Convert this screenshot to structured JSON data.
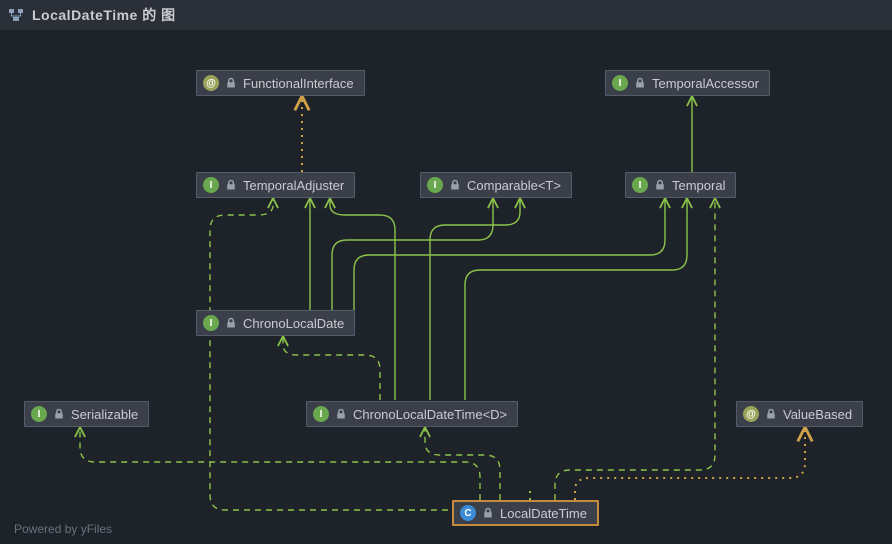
{
  "title": "LocalDateTime 的 图",
  "footer": "Powered by yFiles",
  "nodes": {
    "functionalInterface": {
      "label": "FunctionalInterface",
      "kind": "annotation"
    },
    "temporalAccessor": {
      "label": "TemporalAccessor",
      "kind": "interface"
    },
    "temporalAdjuster": {
      "label": "TemporalAdjuster",
      "kind": "interface"
    },
    "comparable": {
      "label": "Comparable<T>",
      "kind": "interface"
    },
    "temporal": {
      "label": "Temporal",
      "kind": "interface"
    },
    "chronoLocalDate": {
      "label": "ChronoLocalDate",
      "kind": "interface"
    },
    "serializable": {
      "label": "Serializable",
      "kind": "interface"
    },
    "chronoLocalDateTime": {
      "label": "ChronoLocalDateTime<D>",
      "kind": "interface"
    },
    "valueBased": {
      "label": "ValueBased",
      "kind": "annotation"
    },
    "localDateTime": {
      "label": "LocalDateTime",
      "kind": "class",
      "selected": true
    }
  },
  "edges": [
    {
      "from": "temporalAdjuster",
      "to": "functionalInterface",
      "style": "dotA",
      "rel": "annotated-by"
    },
    {
      "from": "temporal",
      "to": "temporalAccessor",
      "style": "solid",
      "rel": "extends"
    },
    {
      "from": "chronoLocalDate",
      "to": "temporalAdjuster",
      "style": "solid",
      "rel": "extends"
    },
    {
      "from": "chronoLocalDate",
      "to": "comparable",
      "style": "solid",
      "rel": "extends"
    },
    {
      "from": "chronoLocalDate",
      "to": "temporal",
      "style": "solid",
      "rel": "extends"
    },
    {
      "from": "chronoLocalDateTime",
      "to": "temporalAdjuster",
      "style": "solid",
      "rel": "extends"
    },
    {
      "from": "chronoLocalDateTime",
      "to": "comparable",
      "style": "solid",
      "rel": "extends"
    },
    {
      "from": "chronoLocalDateTime",
      "to": "temporal",
      "style": "solid",
      "rel": "extends"
    },
    {
      "from": "chronoLocalDateTime",
      "to": "chronoLocalDate",
      "style": "dash",
      "rel": "uses"
    },
    {
      "from": "localDateTime",
      "to": "chronoLocalDateTime",
      "style": "dash",
      "rel": "implements"
    },
    {
      "from": "localDateTime",
      "to": "serializable",
      "style": "dash",
      "rel": "implements"
    },
    {
      "from": "localDateTime",
      "to": "temporalAdjuster",
      "style": "dash",
      "rel": "implements"
    },
    {
      "from": "localDateTime",
      "to": "temporal",
      "style": "dash",
      "rel": "implements"
    },
    {
      "from": "localDateTime",
      "to": "valueBased",
      "style": "dotA",
      "rel": "annotated-by"
    },
    {
      "from": "localDateTime",
      "to": "functionalInterface",
      "style": "dotB",
      "rel": "annotated-by"
    }
  ]
}
